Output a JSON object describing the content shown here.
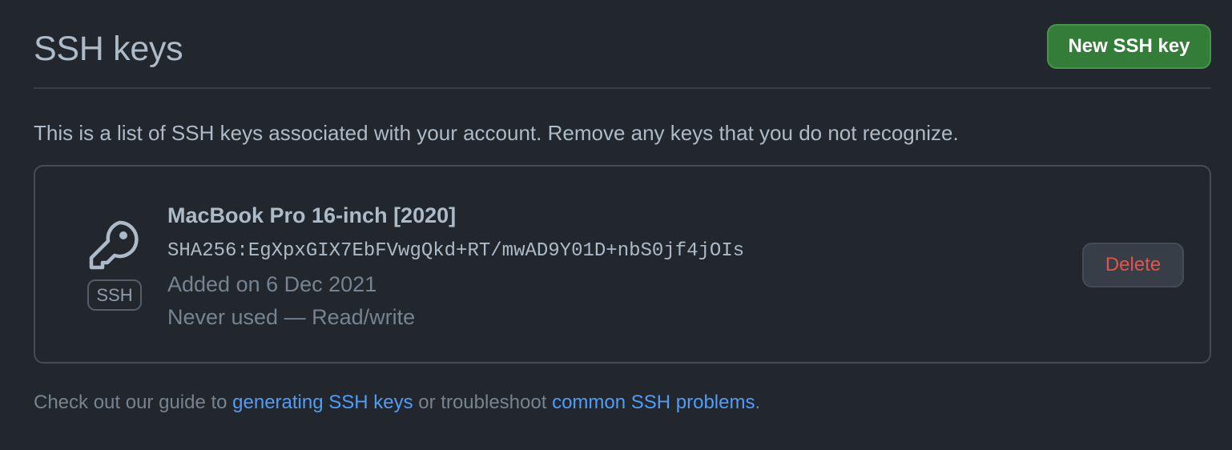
{
  "header": {
    "title": "SSH keys",
    "new_button_label": "New SSH key"
  },
  "intro_text": "This is a list of SSH keys associated with your account. Remove any keys that you do not recognize.",
  "keys": [
    {
      "icon": "key-icon",
      "badge": "SSH",
      "name": "MacBook Pro 16-inch [2020]",
      "fingerprint": "SHA256:EgXpxGIX7EbFVwgQkd+RT/mwAD9Y01D+nbS0jf4jOIs",
      "added": "Added on 6 Dec 2021",
      "usage": "Never used — Read/write",
      "delete_label": "Delete"
    }
  ],
  "footer": {
    "prefix": "Check out our guide to ",
    "link1": "generating SSH keys",
    "middle": " or troubleshoot ",
    "link2": "common SSH problems",
    "suffix": "."
  },
  "colors": {
    "background": "#22272e",
    "primary_button": "#347d39",
    "danger_text": "#e5534b",
    "link": "#539bf5"
  }
}
